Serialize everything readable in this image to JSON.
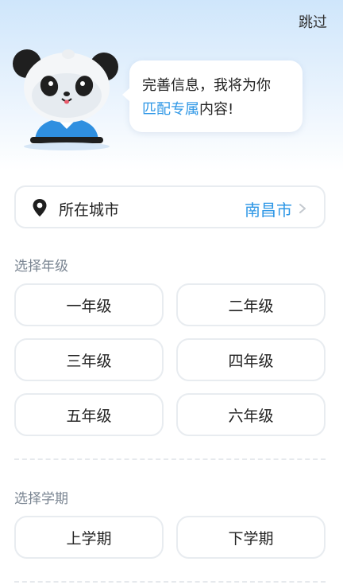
{
  "header": {
    "skip_label": "跳过"
  },
  "mascot": {
    "icon": "panda-mascot"
  },
  "bubble": {
    "line1": "完善信息，我将为你",
    "line2_accent": "匹配专属",
    "line2_rest": "内容!"
  },
  "city": {
    "label": "所在城市",
    "value": "南昌市",
    "icon": "location-pin-icon"
  },
  "grade_section": {
    "title": "选择年级",
    "options": [
      "一年级",
      "二年级",
      "三年级",
      "四年级",
      "五年级",
      "六年级"
    ]
  },
  "term_section": {
    "title": "选择学期",
    "options": [
      "上学期",
      "下学期"
    ]
  },
  "colors": {
    "accent": "#2e97e6",
    "top_gradient": "#cfe6fb",
    "border": "#e8ecf0"
  }
}
